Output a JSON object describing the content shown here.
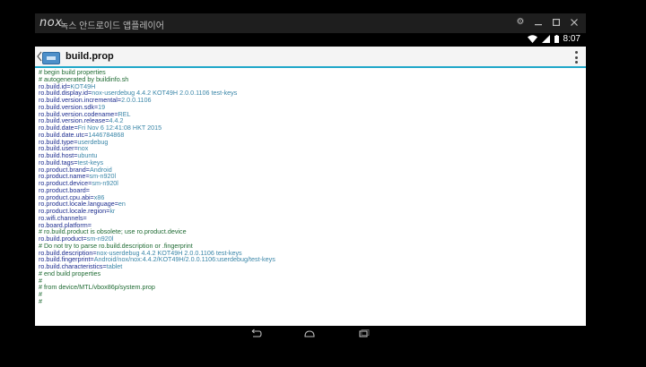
{
  "window": {
    "logo": "nox",
    "title": "녹스 안드로이드 앱플레이어"
  },
  "statusbar": {
    "time": "8:07"
  },
  "actionbar": {
    "title": "build.prop"
  },
  "lines": [
    {
      "t": "comment",
      "text": "# begin build properties"
    },
    {
      "t": "comment",
      "text": "# autogenerated by buildinfo.sh"
    },
    {
      "t": "prop",
      "key": "ro.build.id",
      "value": "KOT49H"
    },
    {
      "t": "prop",
      "key": "ro.build.display.id",
      "value": "nox-userdebug 4.4.2 KOT49H 2.0.0.1106 test-keys"
    },
    {
      "t": "prop",
      "key": "ro.build.version.incremental",
      "value": "2.0.0.1106"
    },
    {
      "t": "prop",
      "key": "ro.build.version.sdk",
      "value": "19"
    },
    {
      "t": "prop",
      "key": "ro.build.version.codename",
      "value": "REL"
    },
    {
      "t": "prop",
      "key": "ro.build.version.release",
      "value": "4.4.2"
    },
    {
      "t": "prop",
      "key": "ro.build.date",
      "value": "Fri Nov  6 12:41:08 HKT 2015"
    },
    {
      "t": "prop",
      "key": "ro.build.date.utc",
      "value": "1446784868"
    },
    {
      "t": "prop",
      "key": "ro.build.type",
      "value": "userdebug"
    },
    {
      "t": "prop",
      "key": "ro.build.user",
      "value": "nox"
    },
    {
      "t": "prop",
      "key": "ro.build.host",
      "value": "ubuntu"
    },
    {
      "t": "prop",
      "key": "ro.build.tags",
      "value": "test-keys"
    },
    {
      "t": "prop",
      "key": "ro.product.brand",
      "value": "Android"
    },
    {
      "t": "prop",
      "key": "ro.product.name",
      "value": "sm-n920l"
    },
    {
      "t": "prop",
      "key": "ro.product.device",
      "value": "sm-n920l"
    },
    {
      "t": "prop",
      "key": "ro.product.board",
      "value": ""
    },
    {
      "t": "prop",
      "key": "ro.product.cpu.abi",
      "value": "x86"
    },
    {
      "t": "prop",
      "key": "ro.product.locale.language",
      "value": "en"
    },
    {
      "t": "prop",
      "key": "ro.product.locale.region",
      "value": "kr"
    },
    {
      "t": "prop",
      "key": "ro.wifi.channels",
      "value": ""
    },
    {
      "t": "prop",
      "key": "ro.board.platform",
      "value": ""
    },
    {
      "t": "comment",
      "text": "# ro.build.product is obsolete; use ro.product.device"
    },
    {
      "t": "prop",
      "key": "ro.build.product",
      "value": "sm-n920l"
    },
    {
      "t": "comment",
      "text": "# Do not try to parse ro.build.description or .fingerprint"
    },
    {
      "t": "prop",
      "key": "ro.build.description",
      "value": "nox-userdebug 4.4.2 KOT49H 2.0.0.1106 test-keys"
    },
    {
      "t": "prop",
      "key": "ro.build.fingerprint",
      "value": "Android/nox/nox:4.4.2/KOT49H/2.0.0.1106:userdebug/test-keys"
    },
    {
      "t": "prop",
      "key": "ro.build.characteristics",
      "value": "tablet"
    },
    {
      "t": "comment",
      "text": "# end build properties"
    },
    {
      "t": "comment",
      "text": "#"
    },
    {
      "t": "comment",
      "text": "# from device/MTL/vbox86p/system.prop"
    },
    {
      "t": "comment",
      "text": "#"
    },
    {
      "t": "comment",
      "text": "#"
    }
  ],
  "icons": {
    "settings": "gear-icon",
    "minimize": "minimize-icon",
    "maximize": "maximize-icon",
    "close": "close-icon",
    "wifi": "wifi-icon",
    "signal": "signal-icon",
    "battery": "battery-icon",
    "back": "back-icon",
    "home": "home-icon",
    "recents": "recents-icon"
  },
  "colors": {
    "accent": "#1fa7c9",
    "comment": "#1f6b33",
    "key": "#1d2d8f",
    "value": "#3a86a8"
  }
}
